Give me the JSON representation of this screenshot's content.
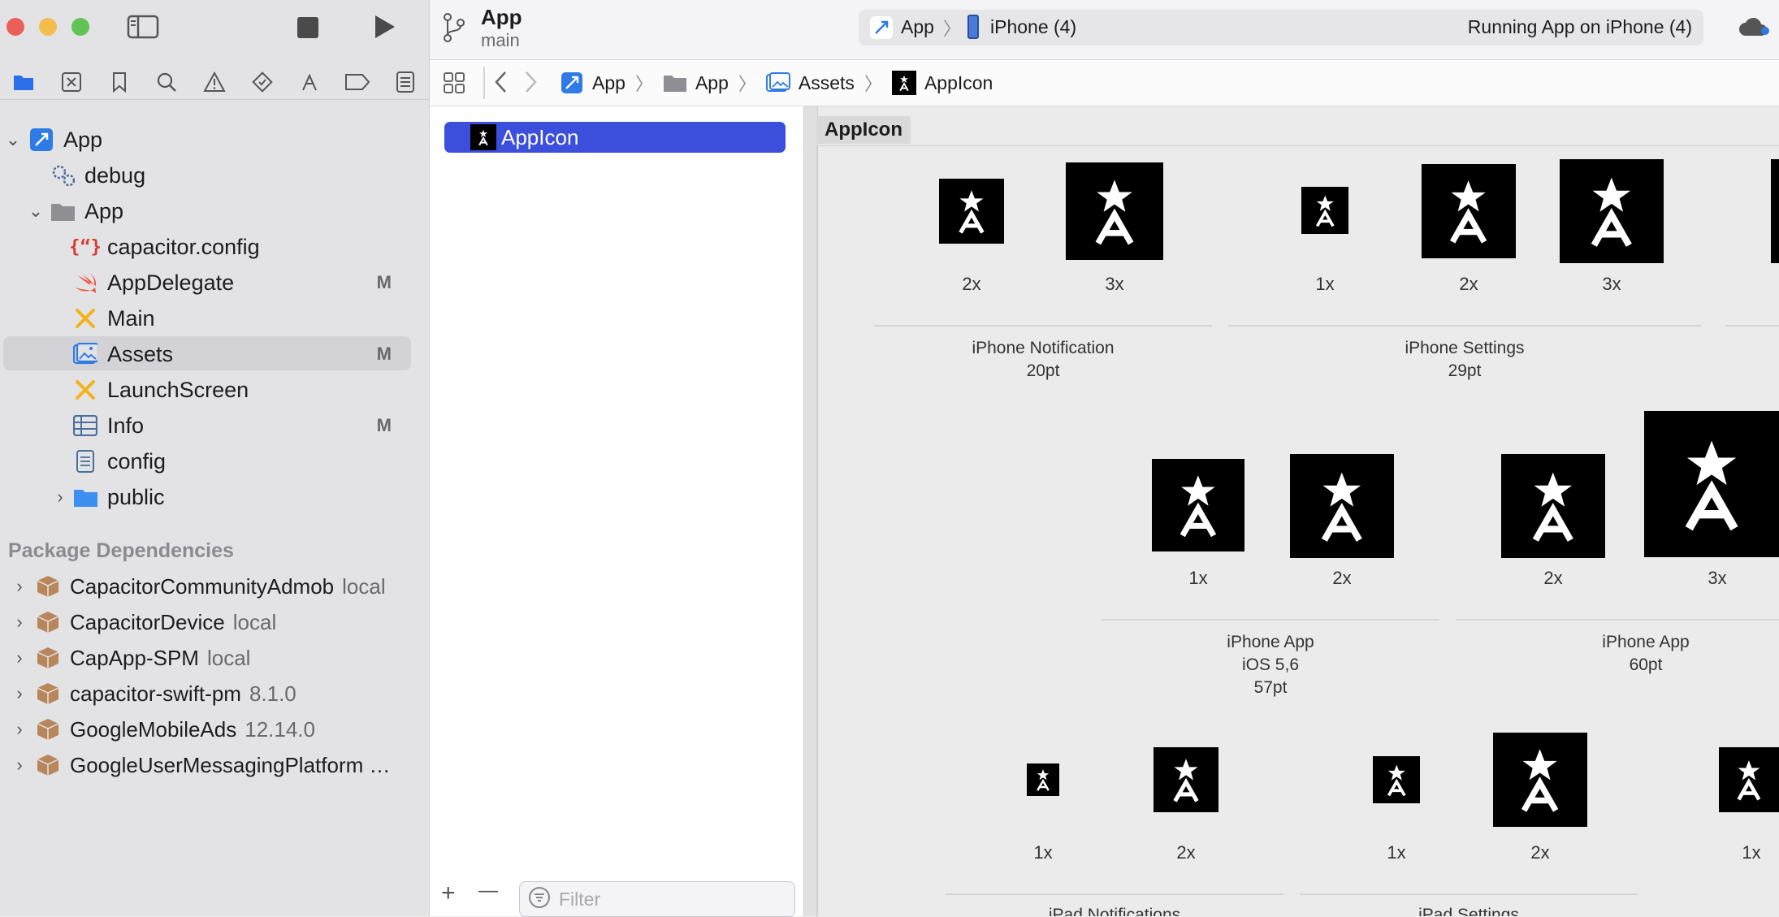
{
  "window": {
    "project_name": "App",
    "branch": "main",
    "scheme": "App",
    "device": "iPhone (4)",
    "status": "Running App on iPhone (4)"
  },
  "navigator": {
    "tree": [
      {
        "label": "App",
        "icon": "project-icon",
        "badge": ""
      },
      {
        "label": "debug",
        "icon": "gear-icon",
        "badge": ""
      },
      {
        "label": "App",
        "icon": "folder-icon",
        "badge": ""
      },
      {
        "label": "capacitor.config",
        "icon": "json-icon",
        "badge": ""
      },
      {
        "label": "AppDelegate",
        "icon": "swift-icon",
        "badge": "M"
      },
      {
        "label": "Main",
        "icon": "storyboard-icon",
        "badge": ""
      },
      {
        "label": "Assets",
        "icon": "assets-icon",
        "badge": "M"
      },
      {
        "label": "LaunchScreen",
        "icon": "storyboard-icon",
        "badge": ""
      },
      {
        "label": "Info",
        "icon": "plist-icon",
        "badge": "M"
      },
      {
        "label": "config",
        "icon": "file-icon",
        "badge": ""
      },
      {
        "label": "public",
        "icon": "folder-icon",
        "badge": ""
      }
    ],
    "package_header": "Package Dependencies",
    "packages": [
      {
        "name": "CapacitorCommunityAdmob",
        "version": "local"
      },
      {
        "name": "CapacitorDevice",
        "version": "local"
      },
      {
        "name": "CapApp-SPM",
        "version": "local"
      },
      {
        "name": "capacitor-swift-pm",
        "version": "8.1.0"
      },
      {
        "name": "GoogleMobileAds",
        "version": "12.14.0"
      },
      {
        "name": "GoogleUserMessagingPlatform …",
        "version": ""
      }
    ]
  },
  "breadcrumb": [
    "App",
    "App",
    "Assets",
    "AppIcon"
  ],
  "asset_list": {
    "selected": "AppIcon",
    "filter_placeholder": "Filter",
    "add": "+",
    "remove": "—"
  },
  "editor": {
    "set_title": "AppIcon",
    "scales": {
      "s1": "2x",
      "s2": "3x",
      "s3": "1x",
      "s4": "2x",
      "s5": "3x",
      "s6": "1x",
      "s7": "2x",
      "s8": "2x",
      "s9": "3x",
      "s10": "1x",
      "s11": "2x",
      "s12": "1x",
      "s13": "2x",
      "s14": "1x"
    },
    "groups": {
      "g1": [
        "iPhone Notification",
        "20pt"
      ],
      "g2": [
        "iPhone Settings",
        "29pt"
      ],
      "g3": [
        "iPhone App",
        "iOS 5,6",
        "57pt"
      ],
      "g4": [
        "iPhone App",
        "60pt"
      ],
      "g5": [
        "iPad Notifications"
      ],
      "g6": [
        "iPad Settings"
      ]
    }
  },
  "colors": {
    "accent": "#3b4fdc",
    "sidebar_bg": "#e3e3e6",
    "selection_gray": "#d3d3d7"
  }
}
